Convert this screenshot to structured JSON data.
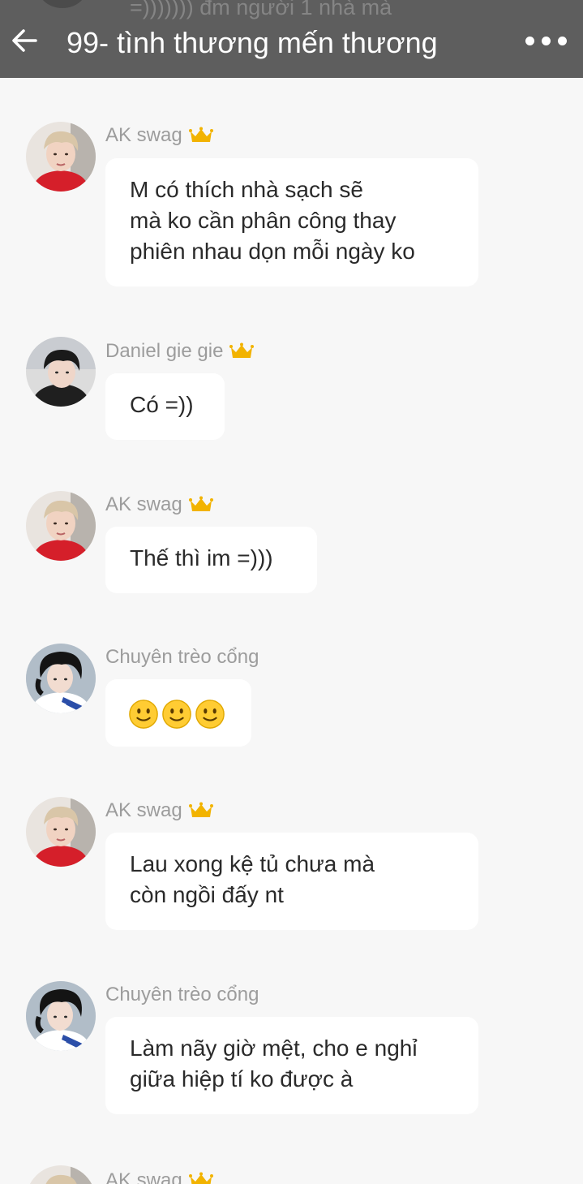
{
  "header": {
    "title": "99- tình thương mến thương",
    "ghost_text": "=))))))) đm người 1 nhà mà"
  },
  "icons": {
    "back": "arrow-left-icon",
    "more": "more-horizontal-icon",
    "crown": "crown-icon",
    "emoji": "slightly-smiling-face-icon"
  },
  "messages": [
    {
      "sender": "AK swag",
      "lines": [
        "M có thích nhà sạch sẽ",
        "mà ko cần phân công thay",
        "phiên nhau dọn mỗi ngày ko"
      ]
    },
    {
      "sender": "Daniel gie gie",
      "lines": [
        "Có =))"
      ]
    },
    {
      "sender": "AK swag",
      "lines": [
        "Thế thì im =)))"
      ]
    },
    {
      "sender": "Chuyên trèo cổng",
      "lines": [],
      "emoji_count": 3
    },
    {
      "sender": "AK swag",
      "lines": [
        "Lau xong kệ tủ chưa mà",
        "còn ngồi đấy nt"
      ]
    },
    {
      "sender": "Chuyên trèo cổng",
      "lines": [
        "Làm nãy giờ mệt, cho e nghỉ",
        "giữa hiệp tí ko được à"
      ]
    },
    {
      "sender": "AK swag",
      "lines": []
    }
  ],
  "colors": {
    "header_bg": "#5e5e5e",
    "page_bg": "#f7f7f7",
    "bubble_bg": "#ffffff",
    "name_text": "#9c9c9c",
    "crown": "#f2b300",
    "emoji_face": "#ffcc33"
  }
}
